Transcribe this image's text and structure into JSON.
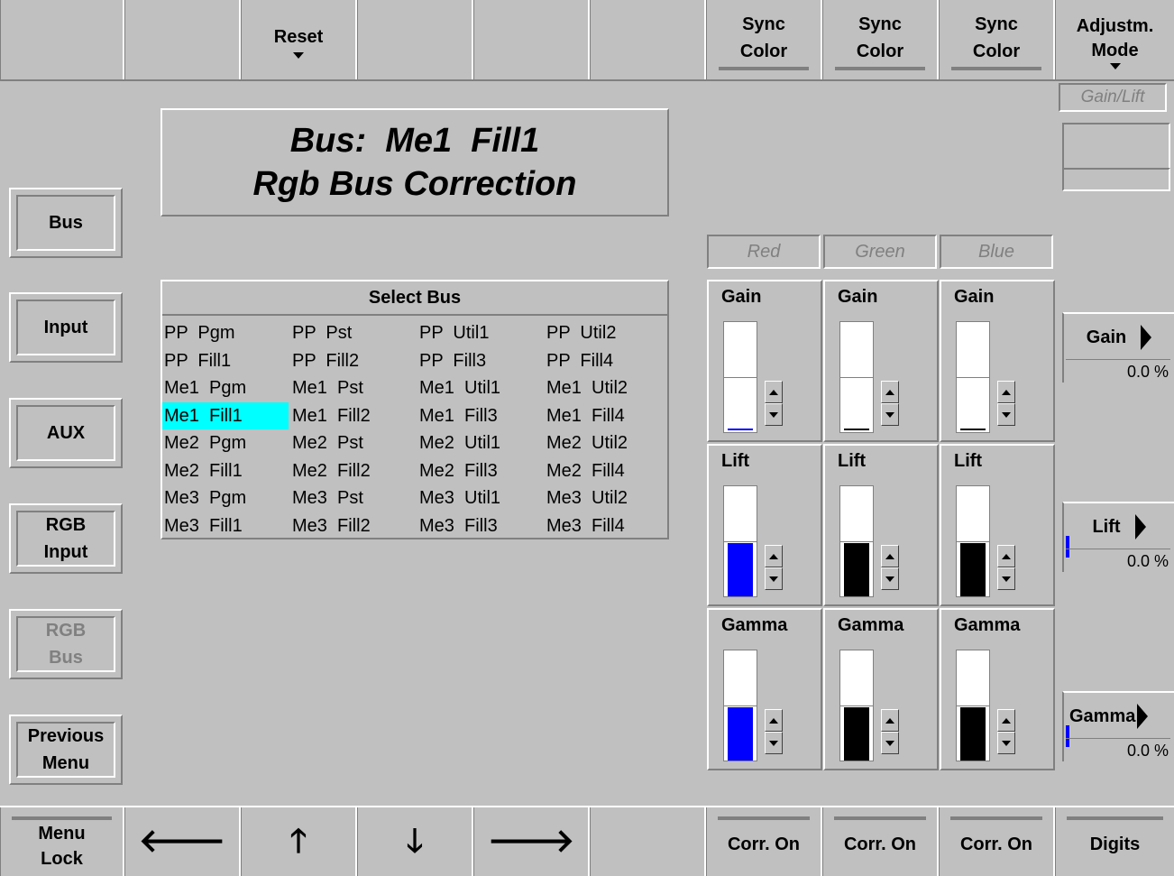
{
  "top_keys": [
    {
      "label": ""
    },
    {
      "label": ""
    },
    {
      "label": "Reset",
      "dropdown": true
    },
    {
      "label": ""
    },
    {
      "label": ""
    },
    {
      "label": ""
    },
    {
      "label1": "Sync",
      "label2": "Color"
    },
    {
      "label1": "Sync",
      "label2": "Color"
    },
    {
      "label1": "Sync",
      "label2": "Color"
    },
    {
      "label1": "Adjustm.",
      "label2": "Mode",
      "dropdown": true
    }
  ],
  "left_buttons": [
    {
      "line1": "Bus",
      "line2": ""
    },
    {
      "line1": "Input",
      "line2": ""
    },
    {
      "line1": "AUX",
      "line2": ""
    },
    {
      "line1": "RGB",
      "line2": "Input"
    },
    {
      "line1": "RGB",
      "line2": "Bus",
      "disabled": true
    },
    {
      "line1": "Previous",
      "line2": "Menu"
    }
  ],
  "title": {
    "line1": "Bus:  Me1  Fill1",
    "line2": "Rgb Bus Correction"
  },
  "bus_list": {
    "header": "Select Bus",
    "selected": "Me1  Fill1",
    "rows": [
      [
        "PP  Pgm",
        "PP  Pst",
        "PP  Util1",
        "PP  Util2"
      ],
      [
        "PP  Fill1",
        "PP  Fill2",
        "PP  Fill3",
        "PP  Fill4"
      ],
      [
        "Me1  Pgm",
        "Me1  Pst",
        "Me1  Util1",
        "Me1  Util2"
      ],
      [
        "Me1  Fill1",
        "Me1  Fill2",
        "Me1  Fill3",
        "Me1  Fill4"
      ],
      [
        "Me2  Pgm",
        "Me2  Pst",
        "Me2  Util1",
        "Me2  Util2"
      ],
      [
        "Me2  Fill1",
        "Me2  Fill2",
        "Me2  Fill3",
        "Me2  Fill4"
      ],
      [
        "Me3  Pgm",
        "Me3  Pst",
        "Me3  Util1",
        "Me3  Util2"
      ],
      [
        "Me3  Fill1",
        "Me3  Fill2",
        "Me3  Fill3",
        "Me3  Fill4"
      ]
    ]
  },
  "channels": [
    {
      "name": "Red",
      "color": "#0000ff",
      "gain_level": 0.0,
      "lift_level": 0.5,
      "gamma_level": 0.5
    },
    {
      "name": "Green",
      "color": "#000000",
      "gain_level": 0.0,
      "lift_level": 0.5,
      "gamma_level": 0.5
    },
    {
      "name": "Blue",
      "color": "#000000",
      "gain_level": 0.0,
      "lift_level": 0.5,
      "gamma_level": 0.5
    }
  ],
  "param_labels": {
    "gain": "Gain",
    "lift": "Lift",
    "gamma": "Gamma"
  },
  "right": {
    "mode": "Gain/Lift",
    "gain": {
      "label": "Gain",
      "value": "0.0 %"
    },
    "lift": {
      "label": "Lift",
      "value": "0.0 %"
    },
    "gamma": {
      "label": "Gamma",
      "value": "0.0 %"
    }
  },
  "bottom_keys": {
    "menu_lock1": "Menu",
    "menu_lock2": "Lock",
    "left": "🡐",
    "up": "🡑",
    "down": "🡓",
    "right": "🡒",
    "corr": [
      "Corr. On",
      "Corr. On",
      "Corr. On"
    ],
    "digits": "Digits"
  },
  "colors": {
    "background": "#c0c0c0",
    "selection": "#00ffff",
    "accent": "#0000ff"
  }
}
